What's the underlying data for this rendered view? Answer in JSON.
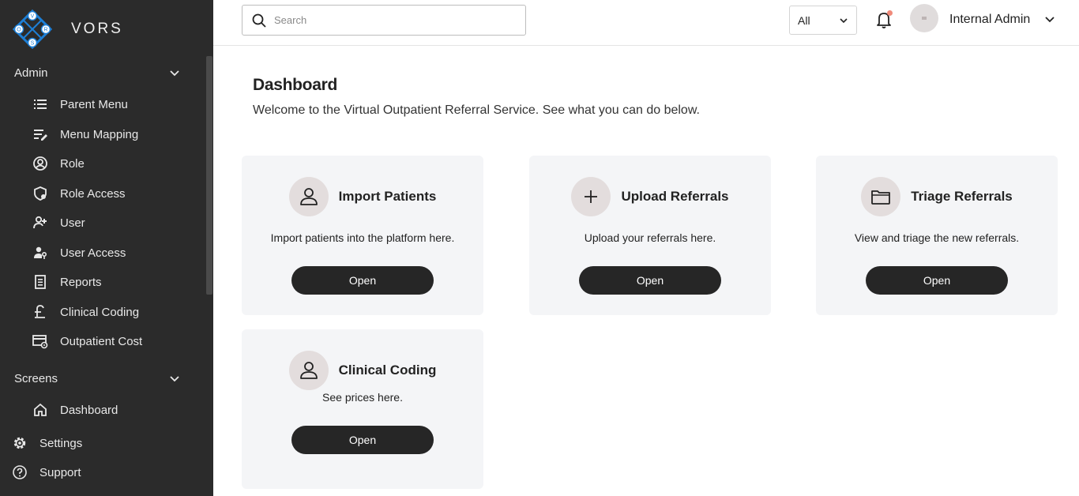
{
  "brand": {
    "name": "VORS",
    "logo_letters": [
      "V",
      "O",
      "R",
      "S"
    ]
  },
  "sidebar": {
    "admin": {
      "label": "Admin",
      "items": [
        {
          "label": "Parent Menu",
          "icon": "list-icon"
        },
        {
          "label": "Menu Mapping",
          "icon": "list-edit-icon"
        },
        {
          "label": "Role",
          "icon": "user-circle-icon"
        },
        {
          "label": "Role Access",
          "icon": "shield-icon"
        },
        {
          "label": "User",
          "icon": "user-add-icon"
        },
        {
          "label": "User Access",
          "icon": "user-key-icon"
        },
        {
          "label": "Reports",
          "icon": "document-icon"
        },
        {
          "label": "Clinical Coding",
          "icon": "pound-icon"
        },
        {
          "label": "Outpatient Cost",
          "icon": "card-settings-icon"
        }
      ]
    },
    "screens": {
      "label": "Screens",
      "items": [
        {
          "label": "Dashboard",
          "icon": "home-icon"
        }
      ]
    },
    "settings_label": "Settings",
    "support_label": "Support"
  },
  "header": {
    "search_placeholder": "Search",
    "filter_value": "All",
    "user_name": "Internal Admin"
  },
  "main": {
    "title": "Dashboard",
    "welcome": "Welcome to the Virtual Outpatient Referral Service. See what you can do below.",
    "cards": [
      {
        "title": "Import Patients",
        "description": "Import patients into the platform here.",
        "button": "Open",
        "icon": "person-icon"
      },
      {
        "title": "Upload Referrals",
        "description": "Upload your referrals here.",
        "button": "Open",
        "icon": "plus-icon"
      },
      {
        "title": "Triage Referrals",
        "description": "View and triage the new referrals.",
        "button": "Open",
        "icon": "folder-icon"
      },
      {
        "title": "Clinical Coding",
        "description": "See prices here.",
        "button": "Open",
        "icon": "person-icon"
      }
    ]
  },
  "colors": {
    "sidebar_bg": "#2b2b2b",
    "card_bg": "#f4f5f7",
    "button_bg": "#262626",
    "brand_blue": "#1d7fd6",
    "notification_dot": "#f08a7a"
  }
}
